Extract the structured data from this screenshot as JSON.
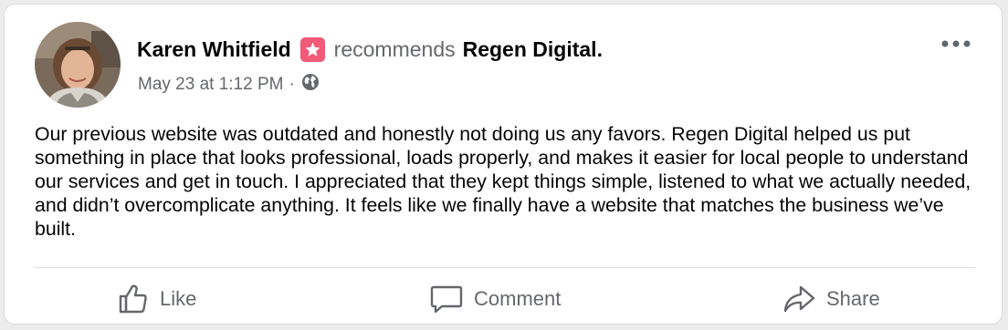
{
  "post": {
    "author": "Karen Whitfield",
    "verb": "recommends",
    "page": "Regen Digital.",
    "timestamp": "May 23 at 1:12 PM",
    "separator": "·",
    "body": "Our previous website was outdated and honestly not doing us any favors. Regen Digital helped us put something in place that looks professional, loads properly, and makes it easier for local people to understand our services and get in touch. I appreciated that they kept things simple, listened to what we actually needed, and didn’t overcomplicate anything. It feels like we finally have a website that matches the business we’ve built.",
    "recommend_badge_color": "#f25a79",
    "audience_icon": "globe-icon",
    "more_icon": "more-options-icon"
  },
  "actions": {
    "like": "Like",
    "comment": "Comment",
    "share": "Share"
  },
  "colors": {
    "text_primary": "#050505",
    "text_secondary": "#65676b",
    "divider": "#dadde1"
  }
}
